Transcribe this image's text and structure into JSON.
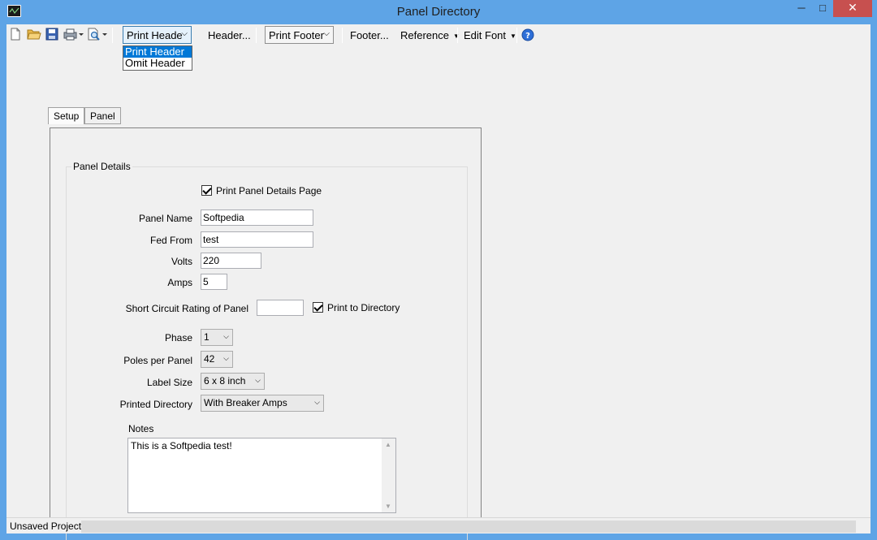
{
  "window": {
    "title": "Panel Directory"
  },
  "toolbar": {
    "header_combo": "Print Heade",
    "header_button": "Header...",
    "footer_combo": "Print Footer",
    "footer_button": "Footer...",
    "reference_menu": "Reference",
    "edit_font_menu": "Edit Font",
    "icons": [
      "new-file-icon",
      "open-folder-icon",
      "save-icon",
      "print-icon",
      "print-preview-icon",
      "help-icon"
    ]
  },
  "header_dropdown": {
    "options": [
      "Print Header",
      "Omit Header"
    ],
    "selected": "Print Header"
  },
  "tabs": [
    {
      "label": "Setup",
      "selected": true
    },
    {
      "label": "Panel",
      "selected": false
    }
  ],
  "panel_details": {
    "group_label": "Panel Details",
    "print_details_label": "Print Panel Details Page",
    "print_details_checked": true,
    "panel_name_label": "Panel Name",
    "panel_name_value": "Softpedia",
    "fed_from_label": "Fed From",
    "fed_from_value": "test",
    "volts_label": "Volts",
    "volts_value": "220",
    "amps_label": "Amps",
    "amps_value": "5",
    "short_circuit_label": "Short Circuit Rating of Panel",
    "short_circuit_value": "",
    "print_to_directory_label": "Print to Directory",
    "print_to_directory_checked": true,
    "phase_label": "Phase",
    "phase_value": "1",
    "poles_label": "Poles per Panel",
    "poles_value": "42",
    "label_size_label": "Label Size",
    "label_size_value": "6 x 8 inch",
    "printed_directory_label": "Printed Directory",
    "printed_directory_value": "With Breaker Amps",
    "notes_label": "Notes",
    "notes_value": "This is a Softpedia test!"
  },
  "status": {
    "text": "Unsaved Project:"
  },
  "colors": {
    "title_bar": "#5ea4e6",
    "close_button": "#c7504f",
    "selection": "#0078d7"
  }
}
